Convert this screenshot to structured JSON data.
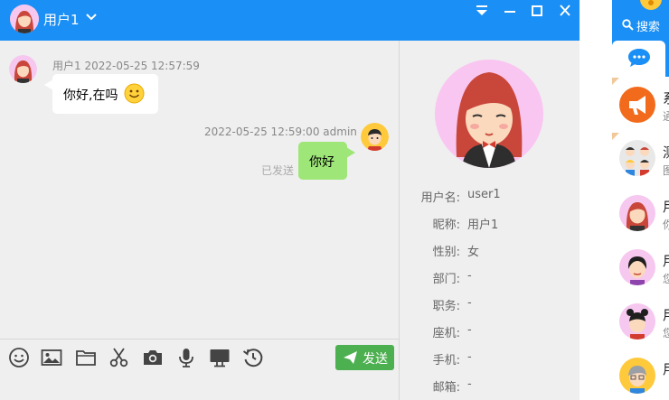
{
  "window": {
    "title": "用户1"
  },
  "messages": [
    {
      "sender": "用户1",
      "time": "2022-05-25 12:57:59",
      "text": "你好,在吗",
      "emoji": "🙂"
    },
    {
      "sender": "admin",
      "time": "2022-05-25 12:59:00",
      "text": "你好",
      "status": "已发送"
    }
  ],
  "toolbar": {
    "icons": [
      "emoji-icon",
      "image-icon",
      "folder-icon",
      "scissors-icon",
      "camera-icon",
      "microphone-icon",
      "monitor-icon",
      "history-icon"
    ],
    "send_label": "发送"
  },
  "profile": {
    "fields": [
      {
        "label": "用户名:",
        "value": "user1"
      },
      {
        "label": "昵称:",
        "value": "用户1"
      },
      {
        "label": "性别:",
        "value": "女"
      },
      {
        "label": "部门:",
        "value": "-"
      },
      {
        "label": "职务:",
        "value": "-"
      },
      {
        "label": "座机:",
        "value": "-"
      },
      {
        "label": "手机:",
        "value": "-"
      },
      {
        "label": "邮箱:",
        "value": "-"
      }
    ]
  },
  "sidebar": {
    "search_label": "搜索",
    "conversations": [
      {
        "name": "系",
        "sub": "通"
      },
      {
        "name": "测",
        "sub": "图"
      },
      {
        "name": "用",
        "sub": "你"
      },
      {
        "name": "用",
        "sub": "您"
      },
      {
        "name": "用",
        "sub": "您"
      },
      {
        "name": "用",
        "sub": ""
      }
    ]
  },
  "colors": {
    "accent": "#1a8ff5",
    "bubble_out": "#9ee678",
    "send_button": "#4caf50",
    "notice_orange": "#f26a1b"
  }
}
